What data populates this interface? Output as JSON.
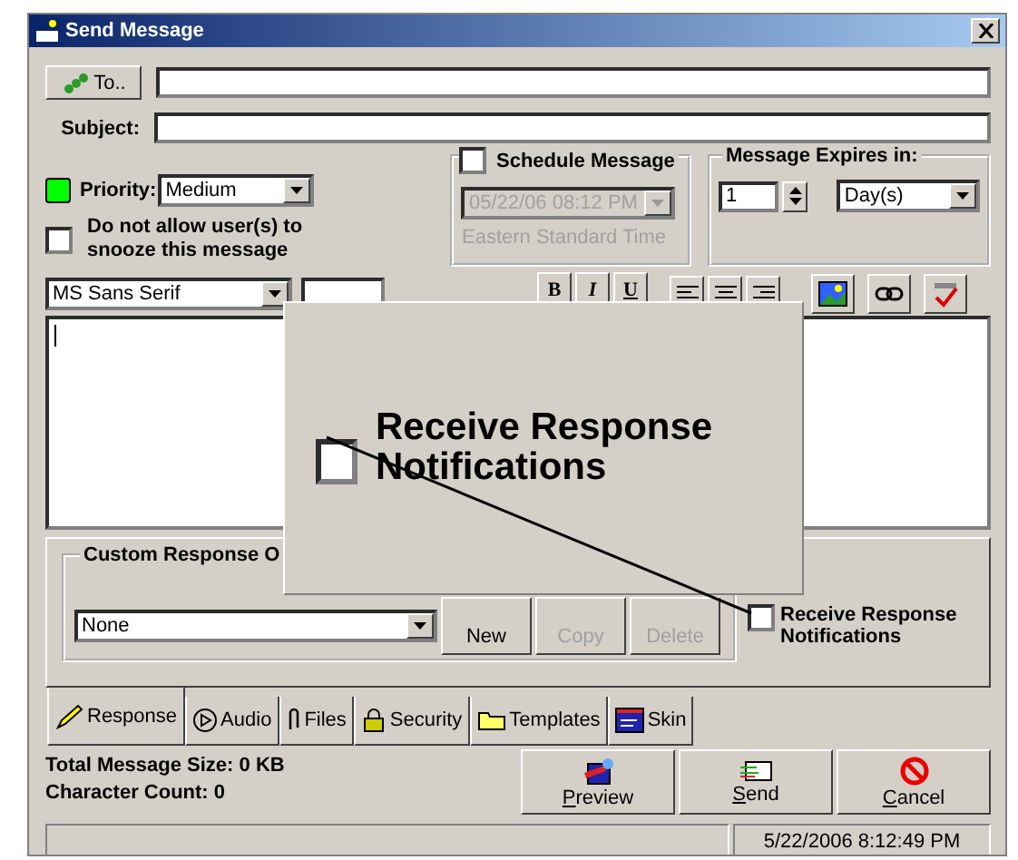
{
  "window": {
    "title": "Send Message"
  },
  "to_button": {
    "label": "To.."
  },
  "subject": {
    "label": "Subject:"
  },
  "priority": {
    "label": "Priority:",
    "value": "Medium",
    "color": "#00ff00"
  },
  "snooze": {
    "label": "Do not allow user(s) to snooze this message",
    "checked": false
  },
  "schedule": {
    "label": "Schedule Message",
    "checked": false,
    "datetime": "05/22/06 08:12 PM",
    "timezone": "Eastern Standard Time"
  },
  "expires": {
    "label": "Message Expires in:",
    "value": "1",
    "unit": "Day(s)"
  },
  "toolbar": {
    "font": "MS Sans Serif",
    "format_buttons": [
      "B",
      "I",
      "U"
    ]
  },
  "response": {
    "group_title": "Custom Response O",
    "option": "None",
    "buttons": [
      {
        "label": "New",
        "disabled": false
      },
      {
        "label": "Copy",
        "disabled": true
      },
      {
        "label": "Delete",
        "disabled": true
      }
    ],
    "receive": {
      "label": "Receive Response Notifications",
      "checked": false
    }
  },
  "tabs": [
    {
      "label": "Response",
      "selected": true
    },
    {
      "label": "Audio",
      "selected": false
    },
    {
      "label": "Files",
      "selected": false
    },
    {
      "label": "Security",
      "selected": false
    },
    {
      "label": "Templates",
      "selected": false
    },
    {
      "label": "Skin",
      "selected": false
    }
  ],
  "stats": [
    "Total Message Size: 0 KB",
    "Character Count: 0"
  ],
  "actions": [
    {
      "label": "Preview",
      "kind": "preview"
    },
    {
      "label": "Send",
      "kind": "send"
    },
    {
      "label": "Cancel",
      "kind": "cancel"
    }
  ],
  "status_bar": {
    "time": "5/22/2006 8:12:49 PM"
  },
  "callout": {
    "label": "Receive Response Notifications",
    "checked": false
  }
}
